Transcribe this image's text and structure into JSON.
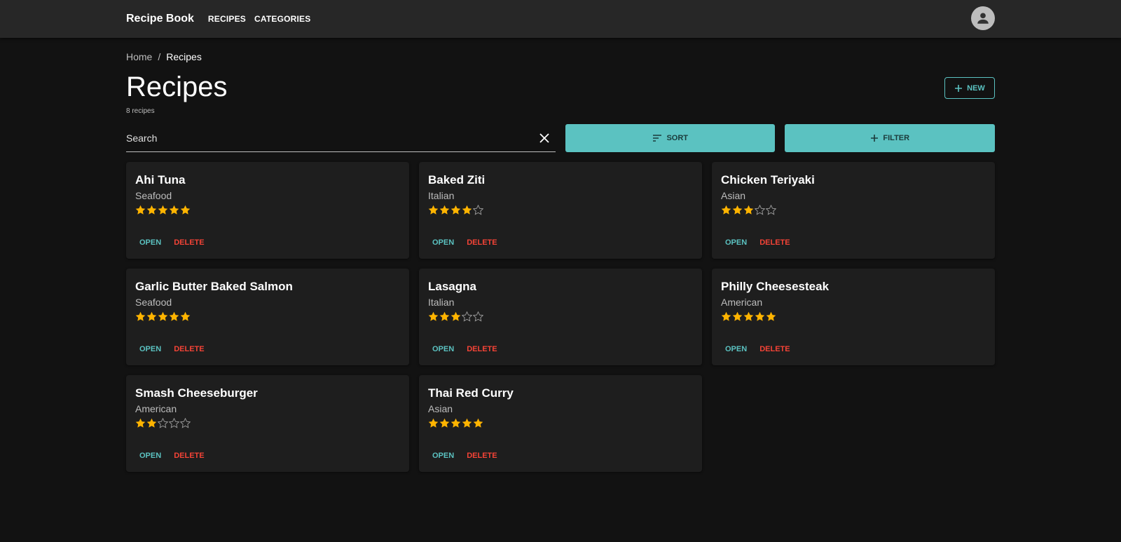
{
  "appbar": {
    "brand": "Recipe Book",
    "nav": [
      "RECIPES",
      "CATEGORIES"
    ]
  },
  "breadcrumb": {
    "home": "Home",
    "separator": "/",
    "current": "Recipes"
  },
  "header": {
    "title": "Recipes",
    "count": "8 recipes",
    "new_label": "NEW"
  },
  "search": {
    "placeholder": "Search",
    "value": ""
  },
  "controls": {
    "sort_label": "SORT",
    "filter_label": "FILTER"
  },
  "colors": {
    "accent": "#5bc2c1",
    "danger": "#f44336",
    "star": "#ffb400",
    "star_empty": "#9e9e9e"
  },
  "card_actions": {
    "open": "OPEN",
    "delete": "DELETE"
  },
  "recipes": [
    {
      "title": "Ahi Tuna",
      "category": "Seafood",
      "rating": 5
    },
    {
      "title": "Baked Ziti",
      "category": "Italian",
      "rating": 4
    },
    {
      "title": "Chicken Teriyaki",
      "category": "Asian",
      "rating": 3
    },
    {
      "title": "Garlic Butter Baked Salmon",
      "category": "Seafood",
      "rating": 5
    },
    {
      "title": "Lasagna",
      "category": "Italian",
      "rating": 3
    },
    {
      "title": "Philly Cheesesteak",
      "category": "American",
      "rating": 5
    },
    {
      "title": "Smash Cheeseburger",
      "category": "American",
      "rating": 2
    },
    {
      "title": "Thai Red Curry",
      "category": "Asian",
      "rating": 5
    }
  ]
}
